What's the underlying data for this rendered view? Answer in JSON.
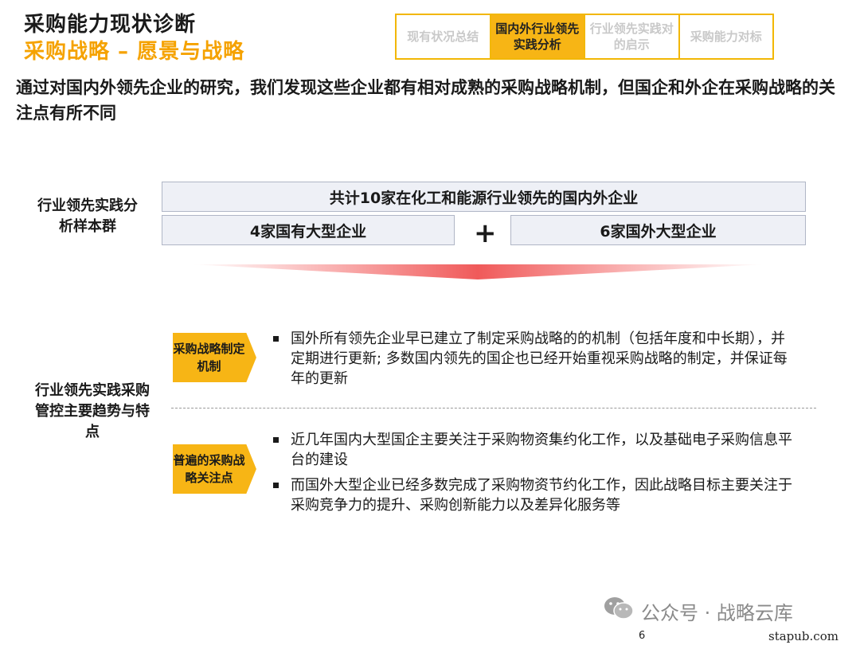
{
  "header": {
    "title": "采购能力现状诊断",
    "subtitle": "采购战略 – 愿景与战略"
  },
  "nav": {
    "tabs": [
      {
        "label": "现有状况总结"
      },
      {
        "label": "国内外行业领先实践分析"
      },
      {
        "label": "行业领先实践对的启示"
      },
      {
        "label": "采购能力对标"
      }
    ],
    "active_index": 1
  },
  "headline": "通过对国内外领先企业的研究，我们发现这些企业都有相对成熟的采购战略机制，但国企和外企在采购战略的关注点有所不同",
  "sample": {
    "label": "行业领先实践分析样本群",
    "total": "共计10家在化工和能源行业领先的国内外企业",
    "domestic": "4家国有大型企业",
    "plus": "+",
    "foreign": "6家国外大型企业"
  },
  "trends": {
    "label": "行业领先实践采购管控主要趋势与特点",
    "items": [
      {
        "tag": "采购战略制定机制",
        "bullets": [
          "国外所有领先企业早已建立了制定采购战略的的机制（包括年度和中长期），并定期进行更新; 多数国内领先的国企也已经开始重视采购战略的制定，并保证每年的更新"
        ]
      },
      {
        "tag": "普遍的采购战略关注点",
        "bullets": [
          "近几年国内大型国企主要关注于采购物资集约化工作，以及基础电子采购信息平台的建设",
          "而国外大型企业已经多数完成了采购物资节约化工作，因此战略目标主要关注于采购竞争力的提升、采购创新能力以及差异化服务等"
        ]
      }
    ]
  },
  "footer": {
    "watermark": "公众号 · 战略云库",
    "page_number": "6",
    "site": "stapub.com"
  },
  "colors": {
    "accent": "#f7b515",
    "accent_border": "#f2b705",
    "subtitle": "#f5a200",
    "box_fill": "#eef0f6",
    "arrow": "#f05a5a"
  }
}
